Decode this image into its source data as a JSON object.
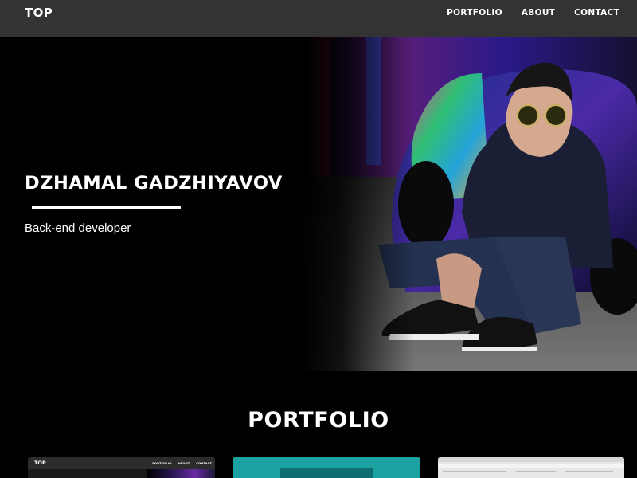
{
  "header": {
    "brand": "TOP",
    "nav": [
      {
        "label": "PORTFOLIO"
      },
      {
        "label": "ABOUT"
      },
      {
        "label": "CONTACT"
      }
    ]
  },
  "hero": {
    "name": "DZHAMAL GADZHIYAVOV",
    "role": "Back-end developer"
  },
  "portfolio": {
    "title": "PORTFOLIO",
    "card_1": {
      "brand": "TOP",
      "nav": [
        "PORTFOLIO",
        "ABOUT",
        "CONTACT"
      ]
    }
  },
  "colors": {
    "navbar_bg": "#333333",
    "page_bg": "#000000",
    "text": "#ffffff",
    "card_teal": "#1aa3a0"
  }
}
